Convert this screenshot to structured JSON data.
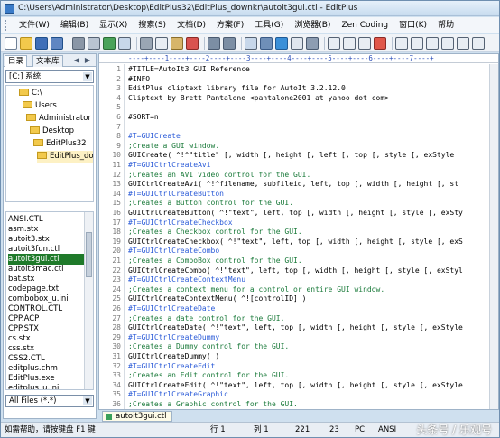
{
  "window": {
    "title": "C:\\Users\\Administrator\\Desktop\\EditPlus32\\EditPlus_downkr\\autoit3gui.ctl - EditPlus"
  },
  "menu": [
    "文件(W)",
    "编辑(B)",
    "显示(X)",
    "搜索(S)",
    "文档(D)",
    "方案(F)",
    "工具(G)",
    "浏览器(B)",
    "Zen Coding",
    "窗口(K)",
    "帮助"
  ],
  "sidebar": {
    "tabs": [
      "目录",
      "文本库"
    ],
    "drive": "[C:] 系统",
    "folders": [
      "C:\\",
      "Users",
      "Administrator",
      "Desktop",
      "EditPlus32",
      "EditPlus_down"
    ],
    "files": [
      "ANSI.CTL",
      "asm.stx",
      "autoit3.stx",
      "autoit3fun.ctl",
      "autoit3gui.ctl",
      "autoit3mac.ctl",
      "bat.stx",
      "codepage.txt",
      "combobox_u.ini",
      "CONTROL.CTL",
      "CPP.ACP",
      "CPP.STX",
      "cs.stx",
      "css.stx",
      "CSS2.CTL",
      "editplus.chm",
      "EditPlus.exe",
      "editplus_u.ini"
    ],
    "selected_file": "autoit3gui.ctl",
    "filter": "All Files (*.*)"
  },
  "editor": {
    "ruler": "----+----1----+----2----+----3----+----4----+----5----+----6----+----7----+",
    "lines": [
      "#TITLE=AutoIt3 GUI Reference",
      "#INFO",
      "EditPlus cliptext library file for AutoIt 3.2.12.0",
      "Cliptext by Brett Pantalone <pantalone2001 at yahoo dot com>",
      "",
      "#SORT=n",
      "",
      "#T=GUICreate",
      ";Create a GUI window.",
      "GUICreate( ^!^\"title\" [, width [, height [, left [, top [, style [, exStyle",
      "#T=GUICtrlCreateAvi",
      ";Creates an AVI video control for the GUI.",
      "GUICtrlCreateAvi( ^!^filename, subfileid, left, top [, width [, height [, st",
      "#T=GUICtrlCreateButton",
      ";Creates a Button control for the GUI.",
      "GUICtrlCreateButton( ^!\"text\", left, top [, width [, height [, style [, exSty",
      "#T=GUICtrlCreateCheckbox",
      ";Creates a Checkbox control for the GUI.",
      "GUICtrlCreateCheckbox( ^!\"text\", left, top [, width [, height [, style [, exS",
      "#T=GUICtrlCreateCombo",
      ";Creates a ComboBox control for the GUI.",
      "GUICtrlCreateCombo( ^!\"text\", left, top [, width [, height [, style [, exStyl",
      "#T=GUICtrlCreateContextMenu",
      ";Creates a context menu for a control or entire GUI window.",
      "GUICtrlCreateContextMenu( ^![controlID] )",
      "#T=GUICtrlCreateDate",
      ";Creates a date control for the GUI.",
      "GUICtrlCreateDate( ^!\"text\", left, top [, width [, height [, style [, exStyle",
      "#T=GUICtrlCreateDummy",
      ";Creates a Dummy control for the GUI.",
      "GUICtrlCreateDummy( )",
      "#T=GUICtrlCreateEdit",
      ";Creates an Edit control for the GUI.",
      "GUICtrlCreateEdit( ^!\"text\", left, top [, width [, height [, style [, exStyle",
      "#T=GUICtrlCreateGraphic",
      ";Creates a Graphic control for the GUI."
    ]
  },
  "doc_tab": "autoit3gui.ctl",
  "status": {
    "help": "如需帮助，请按键盘 F1 键",
    "line": "行 1",
    "col": "列 1",
    "num1": "221",
    "num2": "23",
    "mode": "PC",
    "encoding": "ANSI",
    "watermark": "头条号 / 乐观号"
  },
  "colors": {
    "header": "#2b5bd8",
    "comment": "#1a7a3a",
    "selection": "#1f7a2a"
  },
  "icons": [
    "new-file-icon",
    "open-icon",
    "save-icon",
    "save-all-icon",
    "print-icon",
    "print-preview-icon",
    "spellcheck-icon",
    "find-icon",
    "cut-icon",
    "copy-icon",
    "paste-icon",
    "delete-icon",
    "undo-icon",
    "redo-icon",
    "replace-icon",
    "goto-icon",
    "browser-icon",
    "hex-icon",
    "settings-icon",
    "word-wrap-icon",
    "ruler-icon",
    "line-number-icon",
    "check-icon",
    "window-icon"
  ]
}
